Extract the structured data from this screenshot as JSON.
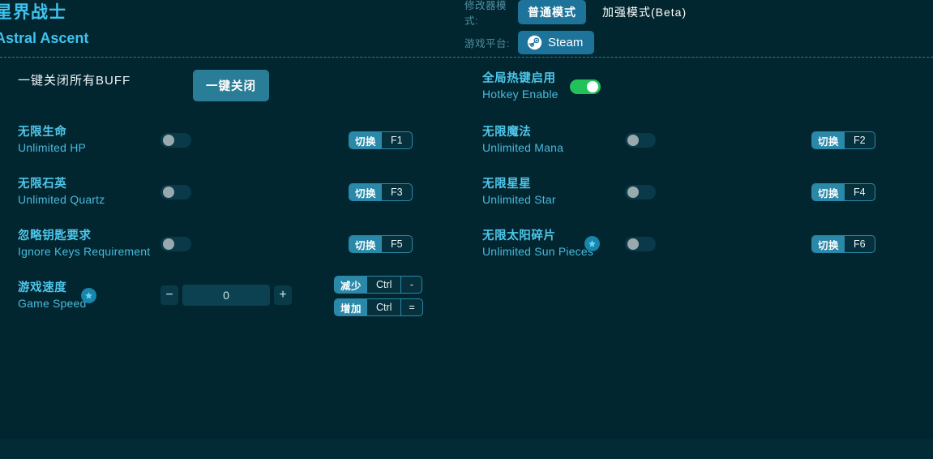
{
  "app": {
    "title_cn": "星界战士",
    "title_en": "Astral Ascent",
    "bg_color": "#02262f",
    "accent_color": "#2a88a8",
    "label_color": "#4fc6ea",
    "toggle_on_color": "#21c25a"
  },
  "header": {
    "mode_label": "修改器模式:",
    "modes": [
      {
        "label": "普通模式",
        "active": true
      },
      {
        "label": "加强模式(Beta)",
        "active": false
      }
    ],
    "platform_label": "游戏平台:",
    "platform": {
      "label": "Steam",
      "icon": "steam-icon"
    }
  },
  "close_all": {
    "label_cn": "一键关闭所有BUFF",
    "button_label": "一键关闭"
  },
  "hotkey_enable": {
    "label_cn": "全局热键启用",
    "label_en": "Hotkey Enable",
    "enabled": true
  },
  "left_rows": [
    {
      "label_cn": "无限生命",
      "label_en": "Unlimited HP",
      "type": "toggle",
      "enabled": false,
      "premium": false,
      "hotkeys": [
        {
          "action": "切换",
          "keys": [
            "F1"
          ]
        }
      ]
    },
    {
      "label_cn": "无限石英",
      "label_en": "Unlimited Quartz",
      "type": "toggle",
      "enabled": false,
      "premium": false,
      "hotkeys": [
        {
          "action": "切换",
          "keys": [
            "F3"
          ]
        }
      ]
    },
    {
      "label_cn": "忽略钥匙要求",
      "label_en": "Ignore Keys Requirement",
      "type": "toggle",
      "enabled": false,
      "premium": false,
      "hotkeys": [
        {
          "action": "切换",
          "keys": [
            "F5"
          ]
        }
      ]
    },
    {
      "label_cn": "游戏速度",
      "label_en": "Game Speed",
      "type": "stepper",
      "value": "0",
      "premium": true,
      "decrease_label": "−",
      "increase_label": "+",
      "hotkeys": [
        {
          "action": "减少",
          "keys": [
            "Ctrl",
            "-"
          ]
        },
        {
          "action": "增加",
          "keys": [
            "Ctrl",
            "="
          ]
        }
      ]
    }
  ],
  "right_rows": [
    {
      "label_cn": "无限魔法",
      "label_en": "Unlimited Mana",
      "type": "toggle",
      "enabled": false,
      "premium": false,
      "hotkeys": [
        {
          "action": "切换",
          "keys": [
            "F2"
          ]
        }
      ]
    },
    {
      "label_cn": "无限星星",
      "label_en": "Unlimited Star",
      "type": "toggle",
      "enabled": false,
      "premium": false,
      "hotkeys": [
        {
          "action": "切换",
          "keys": [
            "F4"
          ]
        }
      ]
    },
    {
      "label_cn": "无限太阳碎片",
      "label_en": "Unlimited Sun Pieces",
      "type": "toggle",
      "enabled": false,
      "premium": true,
      "hotkeys": [
        {
          "action": "切换",
          "keys": [
            "F6"
          ]
        }
      ]
    }
  ]
}
